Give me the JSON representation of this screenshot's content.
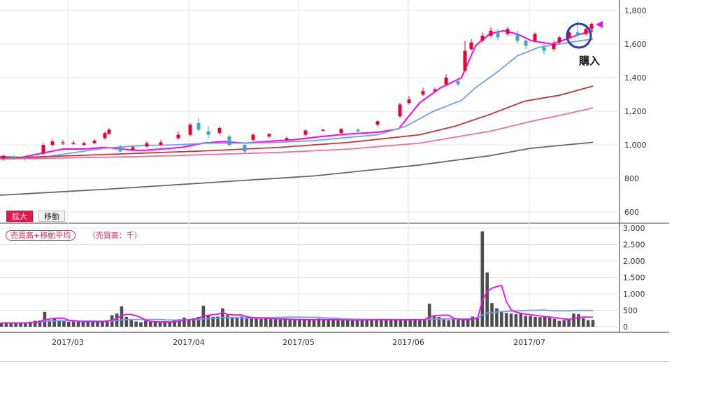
{
  "controls": {
    "zoom_label": "拡大",
    "move_label": "移動"
  },
  "volume_panel": {
    "legend_label": "売買高+移動平均",
    "unit_label": "（売買高：千）"
  },
  "annotation": {
    "text": "購入"
  },
  "colors": {
    "up": "#e60033",
    "down": "#3aa6c8",
    "ma_short": "#ff00ff",
    "ma_mid": "#6f9ff0",
    "ma_long1": "#c83232",
    "ma_long2": "#f06ea0",
    "ma_long3": "#666666",
    "volume_bar": "#4d4d4d",
    "marker": "#ff00ff",
    "circle": "#2c3ea6"
  },
  "chart_data": [
    {
      "type": "candlestick",
      "y_ticks": [
        "1,800",
        "1,600",
        "1,400",
        "1,200",
        "1,000",
        "800",
        "600"
      ],
      "ylim": [
        560,
        1850
      ],
      "x_tick_labels": [
        "2017/03",
        "2017/04",
        "2017/05",
        "2017/06",
        "2017/07"
      ],
      "series": [
        {
          "name": "ma_short",
          "points": [
            [
              0,
              930
            ],
            [
              30,
              925
            ],
            [
              60,
              950
            ],
            [
              90,
              975
            ],
            [
              120,
              975
            ],
            [
              150,
              985
            ],
            [
              175,
              975
            ],
            [
              200,
              965
            ],
            [
              230,
              975
            ],
            [
              260,
              985
            ],
            [
              290,
              1010
            ],
            [
              320,
              1020
            ],
            [
              350,
              1010
            ],
            [
              380,
              1020
            ],
            [
              420,
              1030
            ],
            [
              460,
              1050
            ],
            [
              500,
              1065
            ],
            [
              540,
              1075
            ],
            [
              570,
              1095
            ],
            [
              600,
              1250
            ],
            [
              630,
              1340
            ],
            [
              660,
              1400
            ],
            [
              680,
              1590
            ],
            [
              700,
              1660
            ],
            [
              720,
              1680
            ],
            [
              740,
              1660
            ],
            [
              760,
              1620
            ],
            [
              790,
              1600
            ],
            [
              810,
              1630
            ],
            [
              830,
              1660
            ],
            [
              848,
              1680
            ]
          ]
        },
        {
          "name": "ma_mid",
          "points": [
            [
              0,
              925
            ],
            [
              60,
              925
            ],
            [
              100,
              950
            ],
            [
              150,
              980
            ],
            [
              200,
              995
            ],
            [
              250,
              1000
            ],
            [
              300,
              1010
            ],
            [
              350,
              1010
            ],
            [
              400,
              1015
            ],
            [
              450,
              1025
            ],
            [
              500,
              1045
            ],
            [
              540,
              1060
            ],
            [
              580,
              1110
            ],
            [
              620,
              1200
            ],
            [
              660,
              1265
            ],
            [
              680,
              1340
            ],
            [
              710,
              1430
            ],
            [
              740,
              1530
            ],
            [
              770,
              1580
            ],
            [
              800,
              1600
            ],
            [
              830,
              1620
            ],
            [
              848,
              1630
            ]
          ]
        },
        {
          "name": "ma_long1",
          "points": [
            [
              0,
              920
            ],
            [
              100,
              935
            ],
            [
              200,
              950
            ],
            [
              300,
              965
            ],
            [
              400,
              985
            ],
            [
              500,
              1015
            ],
            [
              600,
              1060
            ],
            [
              650,
              1110
            ],
            [
              700,
              1180
            ],
            [
              750,
              1260
            ],
            [
              800,
              1295
            ],
            [
              848,
              1350
            ]
          ]
        },
        {
          "name": "ma_long2",
          "points": [
            [
              0,
              915
            ],
            [
              200,
              930
            ],
            [
              400,
              955
            ],
            [
              500,
              975
            ],
            [
              600,
              1010
            ],
            [
              700,
              1080
            ],
            [
              760,
              1140
            ],
            [
              800,
              1175
            ],
            [
              848,
              1220
            ]
          ]
        },
        {
          "name": "ma_long3",
          "points": [
            [
              0,
              700
            ],
            [
              150,
              735
            ],
            [
              300,
              775
            ],
            [
              450,
              815
            ],
            [
              600,
              880
            ],
            [
              700,
              935
            ],
            [
              760,
              980
            ],
            [
              848,
              1015
            ]
          ]
        }
      ],
      "candles": [
        {
          "x": 5,
          "open": 920,
          "close": 935,
          "high": 940,
          "low": 905
        },
        {
          "x": 20,
          "open": 930,
          "close": 920,
          "high": 940,
          "low": 910
        },
        {
          "x": 35,
          "open": 925,
          "close": 915,
          "high": 935,
          "low": 905
        },
        {
          "x": 62,
          "open": 950,
          "close": 1000,
          "high": 1010,
          "low": 940
        },
        {
          "x": 75,
          "open": 1000,
          "close": 1020,
          "high": 1035,
          "low": 990
        },
        {
          "x": 90,
          "open": 1010,
          "close": 1015,
          "high": 1030,
          "low": 1000
        },
        {
          "x": 105,
          "open": 1010,
          "close": 1012,
          "high": 1025,
          "low": 1000
        },
        {
          "x": 120,
          "open": 1000,
          "close": 1010,
          "high": 1020,
          "low": 995
        },
        {
          "x": 135,
          "open": 1010,
          "close": 1025,
          "high": 1035,
          "low": 1005
        },
        {
          "x": 150,
          "open": 1040,
          "close": 1070,
          "high": 1080,
          "low": 1030
        },
        {
          "x": 156,
          "open": 1065,
          "close": 1090,
          "high": 1100,
          "low": 1060
        },
        {
          "x": 172,
          "open": 990,
          "close": 960,
          "high": 1000,
          "low": 955
        },
        {
          "x": 190,
          "open": 970,
          "close": 985,
          "high": 995,
          "low": 965
        },
        {
          "x": 210,
          "open": 990,
          "close": 1010,
          "high": 1020,
          "low": 985
        },
        {
          "x": 230,
          "open": 1000,
          "close": 1015,
          "high": 1030,
          "low": 995
        },
        {
          "x": 255,
          "open": 1040,
          "close": 1060,
          "high": 1080,
          "low": 1030
        },
        {
          "x": 272,
          "open": 1060,
          "close": 1120,
          "high": 1130,
          "low": 1050
        },
        {
          "x": 284,
          "open": 1130,
          "close": 1090,
          "high": 1160,
          "low": 1080
        },
        {
          "x": 298,
          "open": 1080,
          "close": 1060,
          "high": 1110,
          "low": 1040
        },
        {
          "x": 314,
          "open": 1070,
          "close": 1100,
          "high": 1110,
          "low": 1060
        },
        {
          "x": 328,
          "open": 1050,
          "close": 1000,
          "high": 1060,
          "low": 990
        },
        {
          "x": 350,
          "open": 1000,
          "close": 960,
          "high": 1010,
          "low": 950
        },
        {
          "x": 362,
          "open": 1030,
          "close": 1060,
          "high": 1070,
          "low": 1020
        },
        {
          "x": 385,
          "open": 1050,
          "close": 1065,
          "high": 1070,
          "low": 1040
        },
        {
          "x": 410,
          "open": 1030,
          "close": 1040,
          "high": 1050,
          "low": 1020
        },
        {
          "x": 437,
          "open": 1060,
          "close": 1085,
          "high": 1095,
          "low": 1050
        },
        {
          "x": 462,
          "open": 1085,
          "close": 1090,
          "high": 1095,
          "low": 1080
        },
        {
          "x": 488,
          "open": 1070,
          "close": 1095,
          "high": 1100,
          "low": 1065
        },
        {
          "x": 512,
          "open": 1090,
          "close": 1080,
          "high": 1100,
          "low": 1060
        },
        {
          "x": 540,
          "open": 1120,
          "close": 1140,
          "high": 1145,
          "low": 1110
        },
        {
          "x": 572,
          "open": 1170,
          "close": 1240,
          "high": 1250,
          "low": 1160
        },
        {
          "x": 585,
          "open": 1250,
          "close": 1270,
          "high": 1290,
          "low": 1240
        },
        {
          "x": 605,
          "open": 1300,
          "close": 1320,
          "high": 1340,
          "low": 1290
        },
        {
          "x": 622,
          "open": 1320,
          "close": 1330,
          "high": 1340,
          "low": 1310
        },
        {
          "x": 638,
          "open": 1360,
          "close": 1400,
          "high": 1420,
          "low": 1350
        },
        {
          "x": 655,
          "open": 1380,
          "close": 1360,
          "high": 1400,
          "low": 1350
        },
        {
          "x": 665,
          "open": 1440,
          "close": 1560,
          "high": 1620,
          "low": 1440
        },
        {
          "x": 674,
          "open": 1570,
          "close": 1610,
          "high": 1630,
          "low": 1560
        },
        {
          "x": 690,
          "open": 1620,
          "close": 1650,
          "high": 1670,
          "low": 1610
        },
        {
          "x": 702,
          "open": 1650,
          "close": 1680,
          "high": 1700,
          "low": 1640
        },
        {
          "x": 712,
          "open": 1670,
          "close": 1640,
          "high": 1690,
          "low": 1620
        },
        {
          "x": 726,
          "open": 1660,
          "close": 1690,
          "high": 1700,
          "low": 1650
        },
        {
          "x": 740,
          "open": 1660,
          "close": 1620,
          "high": 1680,
          "low": 1600
        },
        {
          "x": 752,
          "open": 1620,
          "close": 1590,
          "high": 1640,
          "low": 1570
        },
        {
          "x": 765,
          "open": 1620,
          "close": 1660,
          "high": 1670,
          "low": 1610
        },
        {
          "x": 778,
          "open": 1580,
          "close": 1560,
          "high": 1600,
          "low": 1540
        },
        {
          "x": 792,
          "open": 1570,
          "close": 1600,
          "high": 1620,
          "low": 1560
        },
        {
          "x": 800,
          "open": 1610,
          "close": 1640,
          "high": 1650,
          "low": 1600
        },
        {
          "x": 814,
          "open": 1640,
          "close": 1670,
          "high": 1700,
          "low": 1630
        },
        {
          "x": 826,
          "open": 1670,
          "close": 1650,
          "high": 1740,
          "low": 1640
        },
        {
          "x": 838,
          "open": 1660,
          "close": 1690,
          "high": 1700,
          "low": 1650
        },
        {
          "x": 846,
          "open": 1690,
          "close": 1720,
          "high": 1730,
          "low": 1680
        }
      ]
    },
    {
      "type": "bar",
      "y_ticks": [
        "3,000",
        "2,500",
        "2,000",
        "1,500",
        "1,000",
        "500",
        "0"
      ],
      "ylim": [
        0,
        3000
      ],
      "values": [
        120,
        120,
        110,
        110,
        120,
        130,
        150,
        180,
        190,
        450,
        200,
        260,
        200,
        180,
        150,
        160,
        150,
        140,
        190,
        160,
        150,
        140,
        200,
        350,
        400,
        620,
        300,
        200,
        160,
        140,
        180,
        150,
        140,
        130,
        160,
        150,
        200,
        230,
        280,
        200,
        260,
        300,
        640,
        350,
        300,
        310,
        560,
        350,
        300,
        280,
        310,
        280,
        260,
        250,
        240,
        270,
        230,
        230,
        220,
        240,
        230,
        210,
        220,
        220,
        230,
        200,
        250,
        210,
        220,
        210,
        210,
        200,
        210,
        190,
        200,
        230,
        210,
        220,
        200,
        230,
        210,
        210,
        200,
        210,
        230,
        220,
        210,
        200,
        200,
        700,
        350,
        300,
        220,
        200,
        230,
        210,
        240,
        220,
        310,
        290,
        2900,
        1650,
        720,
        560,
        460,
        420,
        400,
        380,
        400,
        330,
        320,
        300,
        290,
        300,
        270,
        240,
        180,
        200,
        240,
        400,
        380,
        260,
        200,
        210
      ]
    }
  ]
}
